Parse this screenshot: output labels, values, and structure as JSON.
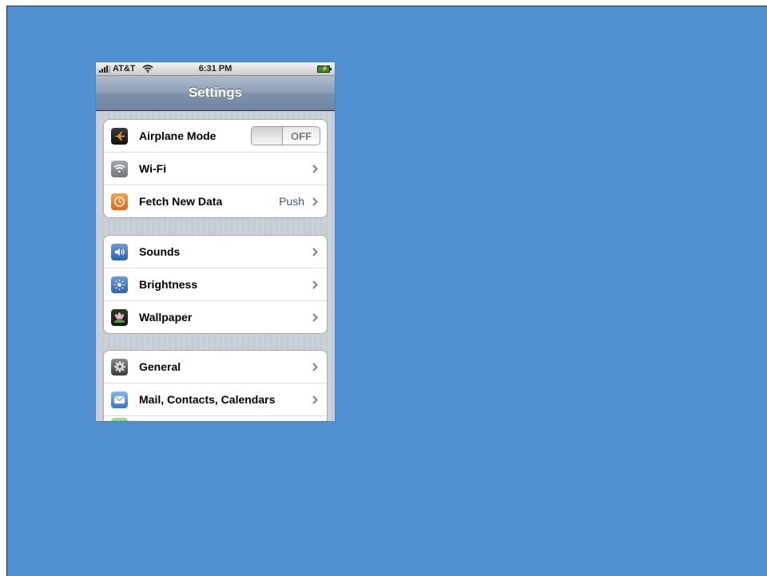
{
  "status_bar": {
    "carrier": "AT&T",
    "time": "6:31 PM",
    "icons": [
      "signal-icon",
      "wifi-icon",
      "battery-icon"
    ]
  },
  "nav": {
    "title": "Settings"
  },
  "groups": [
    {
      "rows": [
        {
          "label": "Airplane Mode",
          "icon": "airplane-icon",
          "toggle": "OFF"
        },
        {
          "label": "Wi-Fi",
          "icon": "wifi-icon",
          "detail": ""
        },
        {
          "label": "Fetch New Data",
          "icon": "clock-icon",
          "detail": "Push"
        }
      ]
    },
    {
      "rows": [
        {
          "label": "Sounds",
          "icon": "speaker-icon"
        },
        {
          "label": "Brightness",
          "icon": "sun-icon"
        },
        {
          "label": "Wallpaper",
          "icon": "flower-icon"
        }
      ]
    },
    {
      "rows": [
        {
          "label": "General",
          "icon": "gear-icon"
        },
        {
          "label": "Mail, Contacts, Calendars",
          "icon": "mail-icon"
        }
      ]
    }
  ],
  "colors": {
    "background": "#508fd0",
    "nav_bar": "#7f92ab",
    "detail_text": "#385487",
    "table_background": "#c5ccd4"
  }
}
